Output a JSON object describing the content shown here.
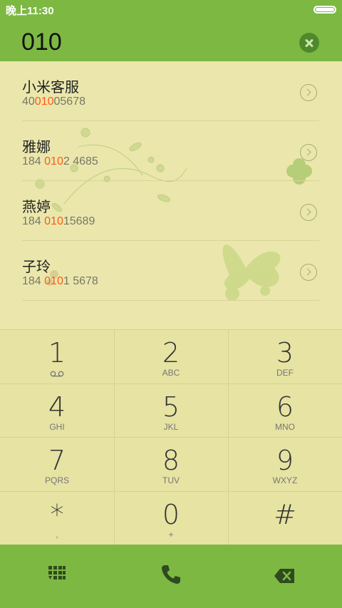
{
  "status_bar": {
    "time": "晚上11:30",
    "battery_icon": "battery-icon"
  },
  "header": {
    "dialed_number": "010",
    "clear_icon": "clear-circle-x-icon"
  },
  "contacts": [
    {
      "name": "小米客服",
      "number_pre": "40",
      "number_match": "010",
      "number_post": "05678"
    },
    {
      "name": "雅娜",
      "number_pre": "184 ",
      "number_match": "010",
      "number_post": "2 4685"
    },
    {
      "name": "燕婷",
      "number_pre": "184 ",
      "number_match": "010",
      "number_post": "15689"
    },
    {
      "name": "子玲",
      "number_pre": "184 ",
      "number_match": "010",
      "number_post": "1 5678"
    }
  ],
  "keypad": [
    {
      "digit": "1",
      "letters": ""
    },
    {
      "digit": "2",
      "letters": "ABC"
    },
    {
      "digit": "3",
      "letters": "DEF"
    },
    {
      "digit": "4",
      "letters": "GHI"
    },
    {
      "digit": "5",
      "letters": "JKL"
    },
    {
      "digit": "6",
      "letters": "MNO"
    },
    {
      "digit": "7",
      "letters": "PQRS"
    },
    {
      "digit": "8",
      "letters": "TUV"
    },
    {
      "digit": "9",
      "letters": "WXYZ"
    },
    {
      "digit": "*",
      "letters": ","
    },
    {
      "digit": "0",
      "letters": "+"
    },
    {
      "digit": "#",
      "letters": ""
    }
  ],
  "bottom_bar": {
    "icons": [
      "dialpad-icon",
      "phone-call-icon",
      "backspace-icon"
    ]
  },
  "colors": {
    "green": "#7db843",
    "background": "#e8e3a6",
    "highlight": "#ff5a16"
  }
}
